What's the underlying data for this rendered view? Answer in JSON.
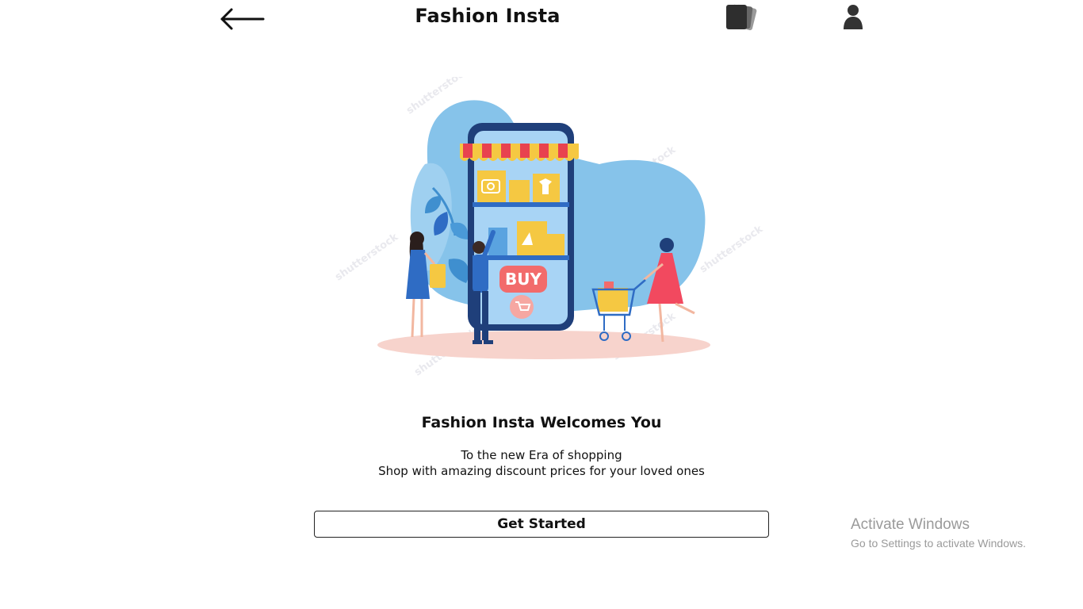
{
  "header": {
    "back_icon": "arrow-left-icon",
    "title": "Fashion Insta",
    "cards_icon": "cards-stack-icon",
    "profile_icon": "user-icon"
  },
  "hero": {
    "illustration": "online-shopping-illustration",
    "buy_label": "BUY",
    "watermark": "shutterstock"
  },
  "welcome": {
    "title": "Fashion Insta Welcomes You",
    "line1": "To the new Era of shopping",
    "line2": "Shop with amazing discount prices for your loved ones"
  },
  "cta": {
    "label": "Get Started"
  },
  "os_overlay": {
    "title": "Activate Windows",
    "subtitle": "Go to Settings to activate Windows."
  },
  "colors": {
    "accent_blue": "#2f6cc4",
    "phone_dark": "#1f3f7a",
    "blob_blue": "#86c3ea",
    "yellow_box": "#f5c842",
    "buy_pink": "#f26b6b",
    "floor_pink": "#f7d3cc",
    "awning_red": "#e8424f"
  }
}
